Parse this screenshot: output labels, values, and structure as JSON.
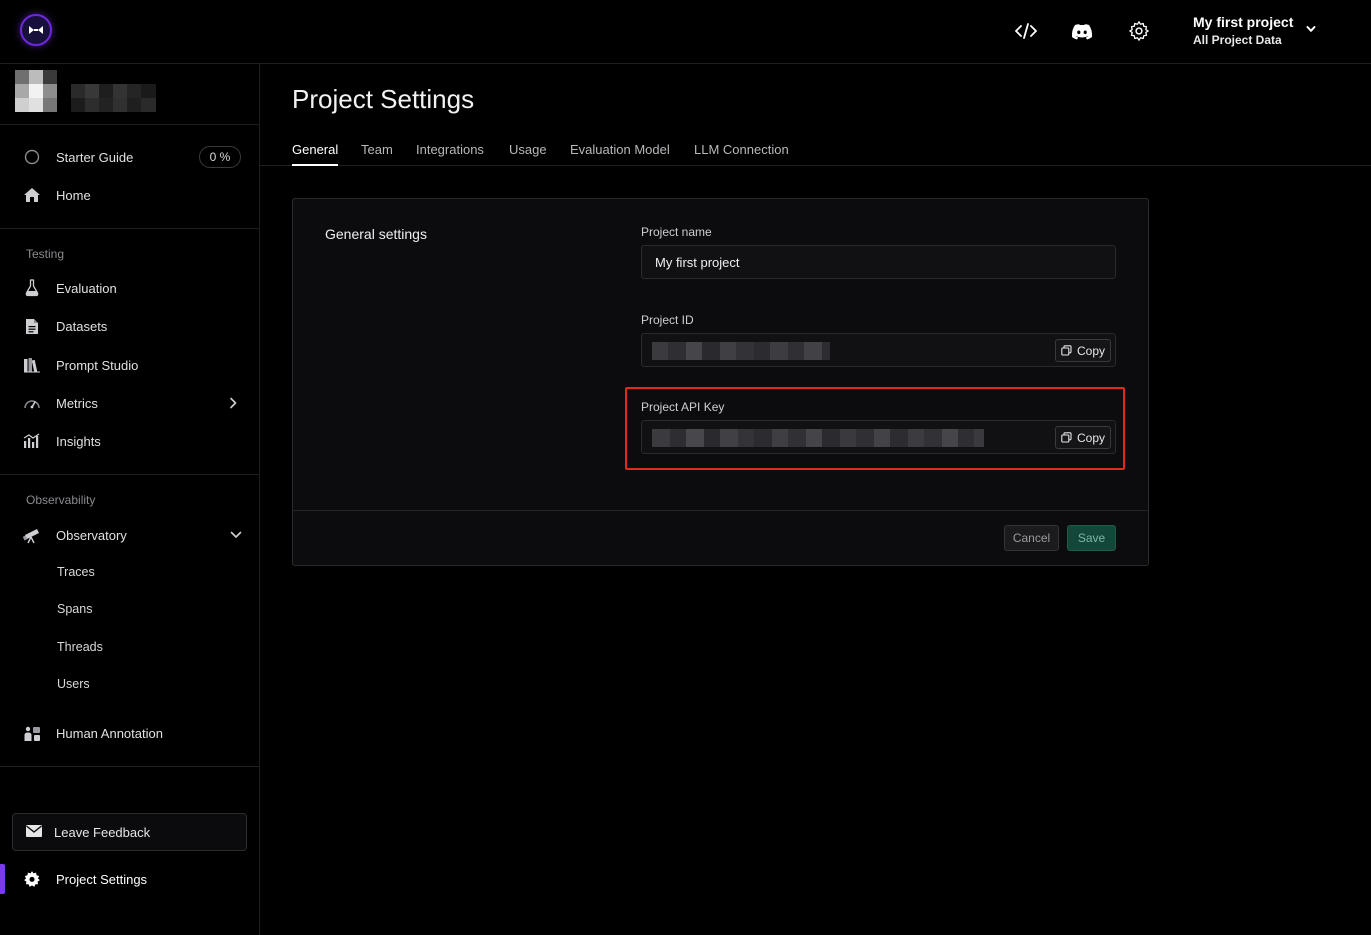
{
  "topbar": {
    "project_name": "My first project",
    "project_scope": "All Project Data"
  },
  "sidebar": {
    "starter_guide": {
      "label": "Starter Guide",
      "progress": "0 %"
    },
    "home": "Home",
    "testing_label": "Testing",
    "testing_items": [
      "Evaluation",
      "Datasets",
      "Prompt Studio",
      "Metrics",
      "Insights"
    ],
    "observability_label": "Observability",
    "observatory": "Observatory",
    "observatory_items": [
      "Traces",
      "Spans",
      "Threads",
      "Users"
    ],
    "human_annotation": "Human Annotation",
    "leave_feedback": "Leave Feedback",
    "project_settings": "Project Settings"
  },
  "main": {
    "title": "Project Settings",
    "tabs": [
      "General",
      "Team",
      "Integrations",
      "Usage",
      "Evaluation Model",
      "LLM Connection"
    ],
    "active_tab": "General",
    "card": {
      "title": "General settings",
      "project_name_label": "Project name",
      "project_name_value": "My first project",
      "project_id_label": "Project ID",
      "api_key_label": "Project API Key",
      "copy_label": "Copy",
      "cancel_label": "Cancel",
      "save_label": "Save"
    }
  },
  "colors": {
    "accent": "#7c3aed",
    "highlight": "#e12a1b",
    "save_bg": "#12473a"
  }
}
